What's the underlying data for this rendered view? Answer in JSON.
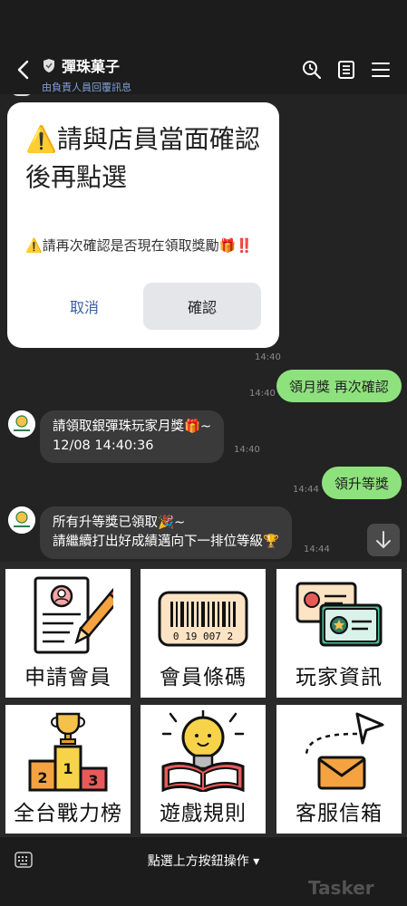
{
  "header": {
    "title": "彈珠菓子",
    "subtitle": "由負責人員回覆訊息"
  },
  "modal": {
    "title": "⚠️請與店員當面確認後再點選",
    "body": "⚠️請再次確認是否現在領取獎勵🎁‼️",
    "cancel_label": "取消",
    "confirm_label": "確認"
  },
  "messages": {
    "time_top": "14:40",
    "m1": {
      "text": "領月獎 再次確認",
      "time": "14:40"
    },
    "m2": {
      "line1": "請領取銀彈珠玩家月獎🎁~",
      "line2": "12/08 14:40:36",
      "time": "14:40"
    },
    "m3": {
      "text": "領升等獎",
      "time": "14:44"
    },
    "m4": {
      "line1": "所有升等獎已領取🎉~",
      "line2": "請繼續打出好成績邁向下一排位等級🏆",
      "time": "14:44"
    }
  },
  "menu": {
    "apply_member": "申請會員",
    "member_barcode": "會員條碼",
    "player_info": "玩家資訊",
    "leaderboard": "全台戰力榜",
    "game_rules": "遊戲規則",
    "service_mail": "客服信箱",
    "barcode_number": "0 19 007 2"
  },
  "bottom": {
    "label": "點選上方按鈕操作 ▾",
    "watermark": "Tasker"
  }
}
